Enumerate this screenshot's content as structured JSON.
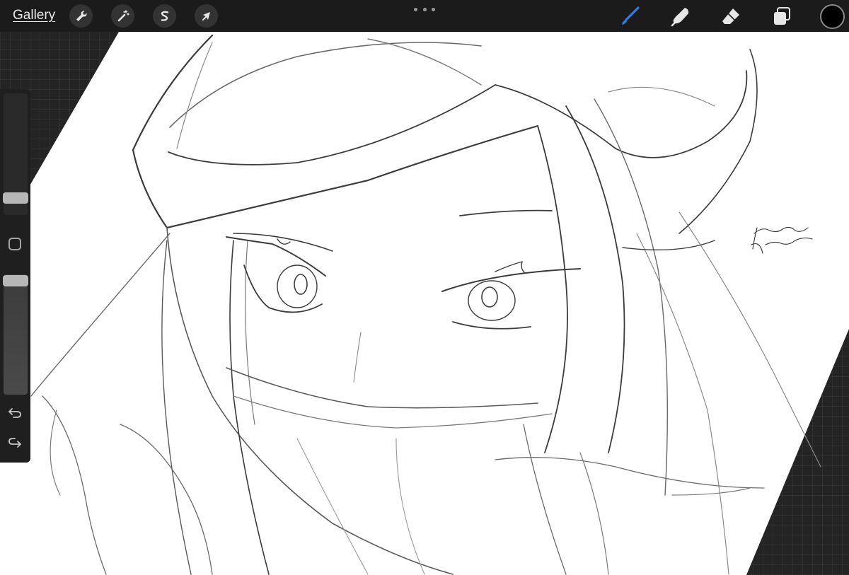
{
  "toolbar": {
    "gallery_label": "Gallery",
    "left_tools": [
      {
        "name": "actions",
        "icon": "wrench-icon"
      },
      {
        "name": "adjustments",
        "icon": "magic-wand-icon"
      },
      {
        "name": "selection",
        "icon": "selection-s-icon"
      },
      {
        "name": "transform",
        "icon": "arrow-cursor-icon"
      }
    ],
    "more_menu_icon": "ellipsis-icon",
    "right_tools": [
      {
        "name": "brush",
        "icon": "brush-icon",
        "active": true
      },
      {
        "name": "smudge",
        "icon": "smudge-finger-icon",
        "active": false
      },
      {
        "name": "eraser",
        "icon": "eraser-icon",
        "active": false
      },
      {
        "name": "layers",
        "icon": "layers-icon",
        "active": false
      }
    ],
    "current_color": "#000000",
    "accent_color": "#2f7de1"
  },
  "sidebar": {
    "brush_size_level": 0.08,
    "modify_button_icon": "square-icon",
    "opacity_level": 1.0,
    "undo_icon": "undo-icon",
    "redo_icon": "redo-icon"
  },
  "canvas": {
    "background": "#ffffff",
    "content": "pencil-sketch",
    "signature_icon": "signature-icon"
  }
}
